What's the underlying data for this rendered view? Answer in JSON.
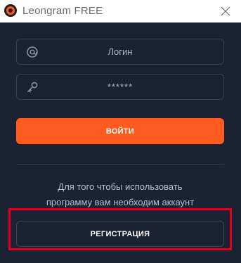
{
  "window": {
    "title": "Leongram FREE",
    "close_icon": "close-icon",
    "logo_icon": "leongram-logo-icon"
  },
  "login_form": {
    "login_placeholder": "Логин",
    "login_icon": "at-sign-icon",
    "password_placeholder": "******",
    "password_icon": "key-icon",
    "login_button_label": "ВОЙТИ"
  },
  "register_section": {
    "info_line1": "Для того чтобы использовать",
    "info_line2": "программу вам необходим аккаунт",
    "register_button_label": "РЕГИСТРАЦИЯ"
  },
  "colors": {
    "background": "#1b2233",
    "accent": "#ff5a1f",
    "highlight": "#e3001b"
  }
}
